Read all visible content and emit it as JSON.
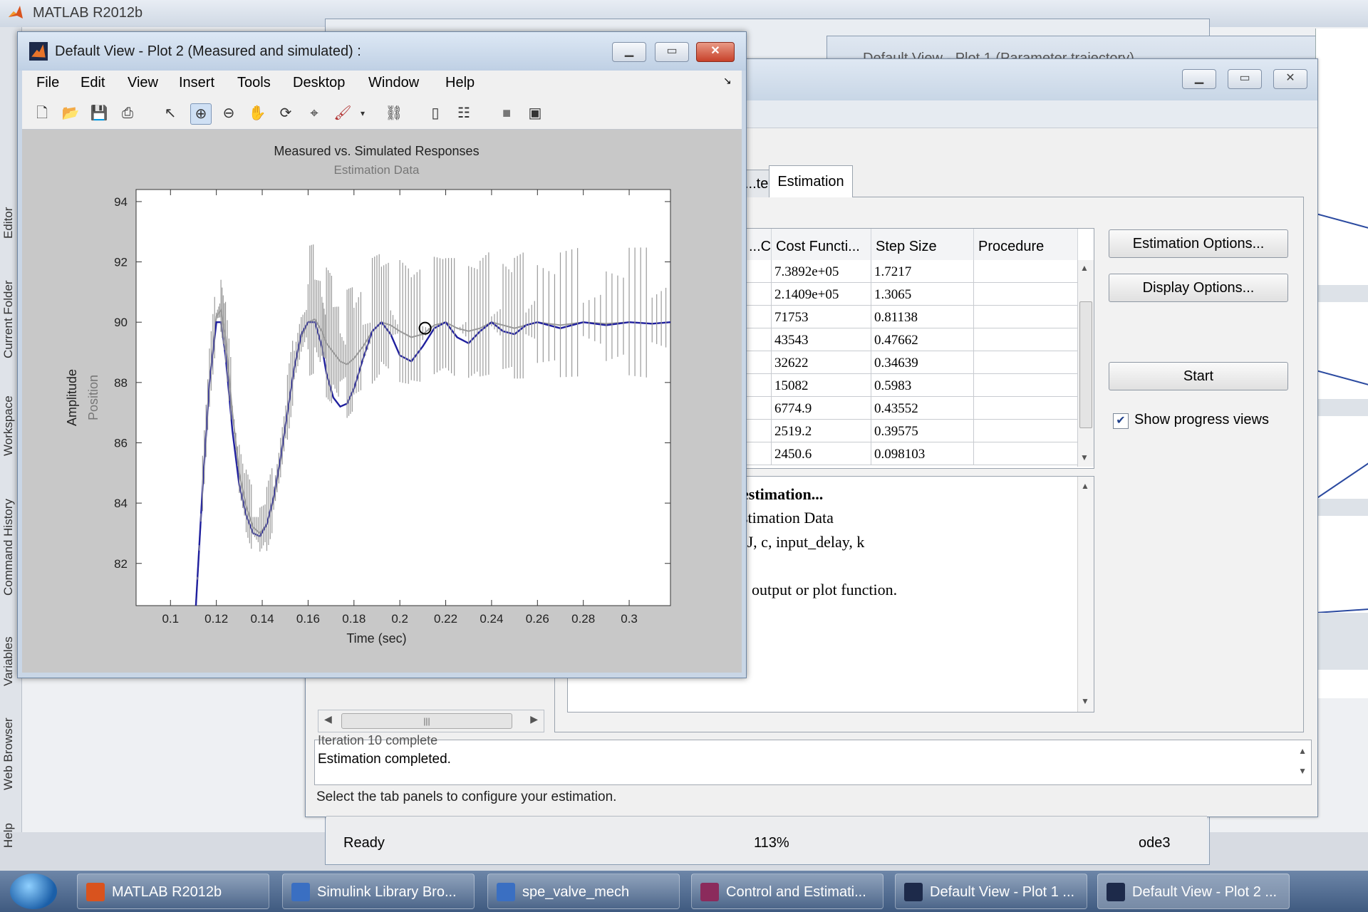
{
  "matlab": {
    "title": "MATLAB R2012b",
    "dock_tabs": [
      "Editor",
      "Current Folder",
      "Workspace",
      "Command History",
      "Variables",
      "Web Browser",
      "Help"
    ]
  },
  "back_window": {
    "title_partial": "Default View - Plot 1 (Parameter trajectory)"
  },
  "estimation_tool": {
    "tabs": [
      "...tes",
      "Estimation"
    ],
    "table": {
      "headers": [
        "...C...",
        "Cost Functi...",
        "Step Size",
        "Procedure"
      ],
      "rows": [
        {
          "cost": "7.3892e+05",
          "step": "1.7217"
        },
        {
          "cost": "2.1409e+05",
          "step": "1.3065"
        },
        {
          "cost": "71753",
          "step": "0.81138"
        },
        {
          "cost": "43543",
          "step": "0.47662"
        },
        {
          "cost": "32622",
          "step": "0.34639"
        },
        {
          "cost": "15082",
          "step": "0.5983"
        },
        {
          "cost": "6774.9",
          "step": "0.43552"
        },
        {
          "cost": "2519.2",
          "step": "0.39575"
        },
        {
          "cost": "2450.6",
          "step": "0.098103"
        }
      ]
    },
    "buttons": {
      "estimation_options": "Estimation Options...",
      "display_options": "Display Options...",
      "start": "Start"
    },
    "show_progress_label": "Show progress views",
    "show_progress_checked": true,
    "log": {
      "line1": "estimation...",
      "line2": "stimation Data",
      "line3": ": J, c, input_delay, k",
      "line4": "output or plot function."
    },
    "status_partial": "Iteration 10 complete",
    "status": "Estimation completed.",
    "hint": "Select the tab panels to configure your estimation.",
    "sim_status": {
      "ready": "Ready",
      "zoom": "113%",
      "solver": "ode3"
    }
  },
  "plot_window": {
    "title": "Default View - Plot 2 (Measured and simulated) :",
    "menu": [
      "File",
      "Edit",
      "View",
      "Insert",
      "Tools",
      "Desktop",
      "Window",
      "Help"
    ],
    "toolbar_icons": [
      "new-file-icon",
      "open-icon",
      "save-icon",
      "print-icon",
      "pointer-icon",
      "zoom-in-icon",
      "zoom-out-icon",
      "pan-icon",
      "rotate-icon",
      "data-cursor-icon",
      "brush-icon",
      "link-icon",
      "colorbar-icon",
      "legend-icon",
      "hide-tools-icon",
      "show-tools-icon"
    ]
  },
  "chart_data": {
    "type": "line",
    "title": "Measured vs. Simulated Responses",
    "subtitle": "Estimation Data",
    "xlabel": "Time (sec)",
    "ylabel": "Amplitude",
    "ylabel2": "Position",
    "xlim": [
      0.085,
      0.318
    ],
    "ylim": [
      80.6,
      94.4
    ],
    "xticks": [
      "0.1",
      "0.12",
      "0.14",
      "0.16",
      "0.18",
      "0.2",
      "0.22",
      "0.24",
      "0.26",
      "0.28",
      "0.3"
    ],
    "yticks": [
      "82",
      "84",
      "86",
      "88",
      "90",
      "92",
      "94"
    ],
    "series": [
      {
        "color": "#9a9a9a",
        "x": [
          0.111,
          0.114,
          0.117,
          0.12,
          0.122,
          0.124,
          0.127,
          0.13,
          0.133,
          0.136,
          0.139,
          0.142,
          0.145,
          0.148,
          0.151,
          0.154,
          0.157,
          0.16,
          0.163,
          0.166,
          0.168,
          0.171,
          0.174,
          0.177,
          0.18,
          0.184,
          0.188,
          0.192,
          0.196,
          0.2,
          0.205,
          0.21,
          0.215,
          0.22,
          0.225,
          0.23,
          0.235,
          0.24,
          0.245,
          0.25,
          0.255,
          0.26,
          0.27,
          0.28,
          0.29,
          0.3,
          0.31,
          0.318
        ],
        "y": [
          80.5,
          84.5,
          88,
          90.2,
          90.4,
          89.5,
          87,
          85,
          83.9,
          83.2,
          83,
          83.3,
          84.1,
          85.4,
          87,
          88.5,
          89.5,
          90,
          90.1,
          89.7,
          89.3,
          89,
          88.7,
          88.6,
          88.8,
          89.2,
          89.7,
          90,
          89.9,
          89.7,
          89.5,
          89.6,
          89.9,
          90,
          89.8,
          89.7,
          89.8,
          90,
          89.9,
          89.8,
          89.9,
          90,
          89.9,
          90,
          89.95,
          90,
          89.95,
          90
        ]
      },
      {
        "color": "#1f1f9e",
        "x": [
          0.111,
          0.114,
          0.117,
          0.12,
          0.122,
          0.124,
          0.127,
          0.13,
          0.133,
          0.136,
          0.139,
          0.142,
          0.145,
          0.148,
          0.151,
          0.154,
          0.157,
          0.16,
          0.163,
          0.166,
          0.168,
          0.171,
          0.174,
          0.177,
          0.18,
          0.184,
          0.188,
          0.192,
          0.196,
          0.2,
          0.205,
          0.21,
          0.215,
          0.22,
          0.225,
          0.23,
          0.235,
          0.24,
          0.245,
          0.25,
          0.255,
          0.26,
          0.27,
          0.28,
          0.29,
          0.3,
          0.31,
          0.318
        ],
        "y": [
          80.5,
          84.5,
          88,
          90.0,
          90.0,
          88.9,
          86.4,
          84.6,
          83.6,
          83.0,
          82.9,
          83.3,
          84.2,
          85.5,
          87.0,
          88.5,
          89.6,
          90.0,
          90.0,
          89.2,
          88.3,
          87.5,
          87.2,
          87.3,
          87.8,
          88.8,
          89.7,
          90.0,
          89.6,
          88.9,
          88.7,
          89.2,
          89.8,
          90.0,
          89.5,
          89.3,
          89.7,
          90.0,
          89.7,
          89.6,
          89.9,
          90.0,
          89.8,
          90.0,
          89.9,
          90.0,
          89.95,
          90.0
        ]
      }
    ]
  }
}
